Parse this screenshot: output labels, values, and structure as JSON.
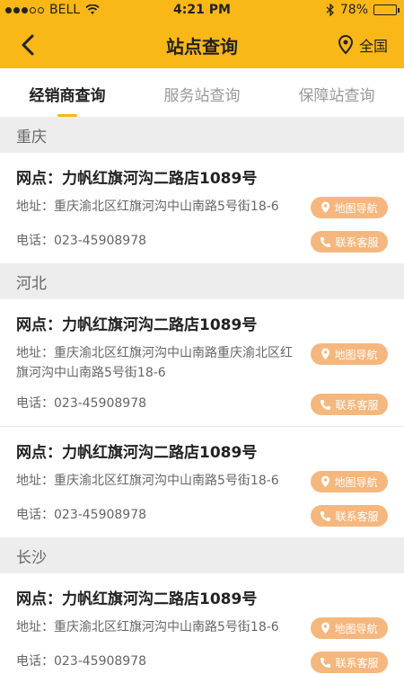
{
  "status_bar": {
    "carrier": "BELL",
    "time": "4:21 PM",
    "battery": "78%",
    "battery_level": 0.78
  },
  "navbar": {
    "title": "站点查询",
    "region": "全国"
  },
  "tabs": [
    {
      "label": "经销商查询",
      "active": true
    },
    {
      "label": "服务站查询",
      "active": false
    },
    {
      "label": "保障站查询",
      "active": false
    }
  ],
  "sections": [
    {
      "name": "重庆",
      "items": [
        {
          "title": "网点：力帆红旗河沟二路店1089号",
          "address": "地址：重庆渝北区红旗河沟中山南路5号街18-6",
          "phone": "电话：023-45908978",
          "nav_label": "地图导航",
          "call_label": "联系客服"
        }
      ]
    },
    {
      "name": "河北",
      "items": [
        {
          "title": "网点：力帆红旗河沟二路店1089号",
          "address": "地址：重庆渝北区红旗河沟中山南路重庆渝北区红旗河沟中山南路5号街18-6",
          "phone": "电话：023-45908978",
          "nav_label": "地图导航",
          "call_label": "联系客服"
        },
        {
          "title": "网点：力帆红旗河沟二路店1089号",
          "address": "地址：重庆渝北区红旗河沟中山南路5号街18-6",
          "phone": "电话：023-45908978",
          "nav_label": "地图导航",
          "call_label": "联系客服"
        }
      ]
    },
    {
      "name": "长沙",
      "items": [
        {
          "title": "网点：力帆红旗河沟二路店1089号",
          "address": "地址：重庆渝北区红旗河沟中山南路5号街18-6",
          "phone": "电话：023-45908978",
          "nav_label": "地图导航",
          "call_label": "联系客服"
        }
      ]
    }
  ],
  "colors": {
    "brand": "#f9b718",
    "pill": "#f5b77e"
  }
}
